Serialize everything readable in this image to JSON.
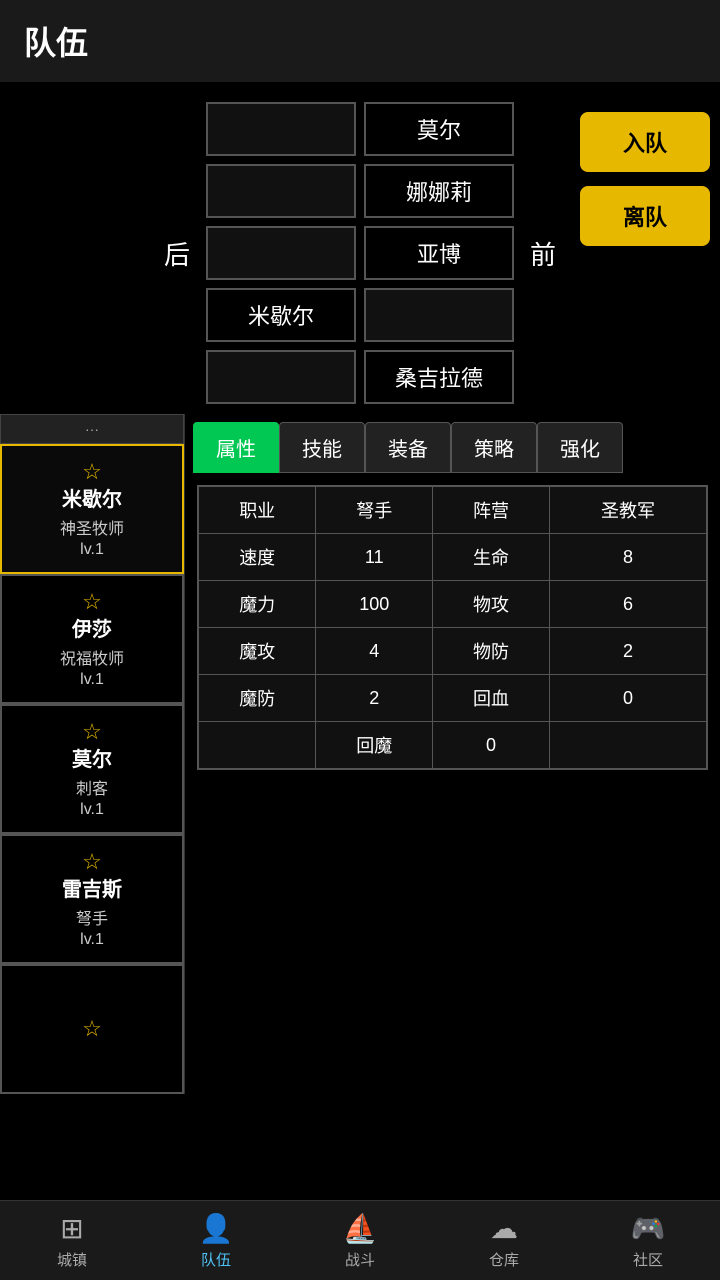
{
  "header": {
    "title": "队伍"
  },
  "formation": {
    "back_label": "后",
    "front_label": "前",
    "rows": [
      [
        {
          "name": "",
          "empty": true
        },
        {
          "name": "莫尔",
          "empty": false
        }
      ],
      [
        {
          "name": "",
          "empty": true
        },
        {
          "name": "娜娜莉",
          "empty": false
        }
      ],
      [
        {
          "name": "",
          "empty": true
        },
        {
          "name": "亚博",
          "empty": false
        }
      ],
      [
        {
          "name": "米歇尔",
          "empty": false
        },
        {
          "name": "",
          "empty": true
        }
      ],
      [
        {
          "name": "",
          "empty": true
        },
        {
          "name": "桑吉拉德",
          "empty": false
        }
      ]
    ],
    "join_label": "入队",
    "leave_label": "离队"
  },
  "tabs": [
    {
      "label": "属性",
      "active": true
    },
    {
      "label": "技能",
      "active": false
    },
    {
      "label": "装备",
      "active": false
    },
    {
      "label": "策略",
      "active": false
    },
    {
      "label": "强化",
      "active": false
    }
  ],
  "stats_table": {
    "headers": [
      "职业",
      "弩手",
      "阵营",
      "圣教军"
    ],
    "rows": [
      [
        "速度",
        "11",
        "生命",
        "8"
      ],
      [
        "魔力",
        "100",
        "物攻",
        "6"
      ],
      [
        "魔攻",
        "4",
        "物防",
        "2"
      ],
      [
        "魔防",
        "2",
        "回血",
        "0"
      ],
      [
        "",
        "回魔",
        "0",
        ""
      ]
    ]
  },
  "party_members": [
    {
      "name": "米歇尔",
      "class": "神圣牧师",
      "level": "lv.1",
      "active": true
    },
    {
      "name": "伊莎",
      "class": "祝福牧师",
      "level": "lv.1",
      "active": false
    },
    {
      "name": "莫尔",
      "class": "刺客",
      "level": "lv.1",
      "active": false
    },
    {
      "name": "雷吉斯",
      "class": "弩手",
      "level": "lv.1",
      "active": false
    },
    {
      "name": "...",
      "class": "",
      "level": "",
      "active": false
    }
  ],
  "bottom_nav": [
    {
      "label": "城镇",
      "icon": "🏛",
      "active": false
    },
    {
      "label": "队伍",
      "icon": "👥",
      "active": true
    },
    {
      "label": "战斗",
      "icon": "🚢",
      "active": false
    },
    {
      "label": "仓库",
      "icon": "☁",
      "active": false
    },
    {
      "label": "社区",
      "icon": "🎮",
      "active": false
    }
  ]
}
